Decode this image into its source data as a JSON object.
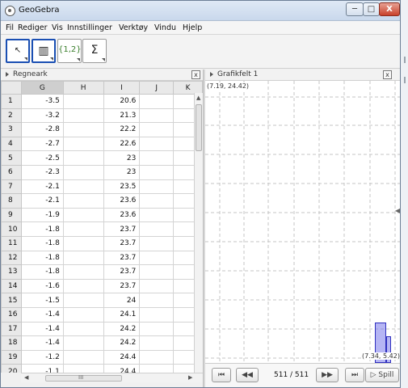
{
  "window": {
    "title": "GeoGebra",
    "min_glyph": "─",
    "max_glyph": "□",
    "close_glyph": "X"
  },
  "menu": [
    "Fil",
    "Rediger",
    "Vis",
    "Innstillinger",
    "Verktøy",
    "Vindu",
    "Hjelp"
  ],
  "toolbar": {
    "tools": [
      {
        "name": "move-tool",
        "glyph": "↖",
        "active": true
      },
      {
        "name": "histogram-tool",
        "glyph": "▥",
        "active": true
      },
      {
        "name": "list-tool",
        "glyph": "{1,2}",
        "active": false
      },
      {
        "name": "sum-tool",
        "glyph": "Σ",
        "active": false
      }
    ],
    "help_glyph": "?",
    "redo_glyph": "➦"
  },
  "spreadsheet": {
    "title": "Regneark",
    "close_glyph": "x",
    "columns": [
      "G",
      "H",
      "I",
      "J",
      "K"
    ],
    "rows": [
      {
        "n": "1",
        "G": "-3.5",
        "I": "20.6"
      },
      {
        "n": "2",
        "G": "-3.2",
        "I": "21.3"
      },
      {
        "n": "3",
        "G": "-2.8",
        "I": "22.2"
      },
      {
        "n": "4",
        "G": "-2.7",
        "I": "22.6"
      },
      {
        "n": "5",
        "G": "-2.5",
        "I": "23"
      },
      {
        "n": "6",
        "G": "-2.3",
        "I": "23"
      },
      {
        "n": "7",
        "G": "-2.1",
        "I": "23.5"
      },
      {
        "n": "8",
        "G": "-2.1",
        "I": "23.6"
      },
      {
        "n": "9",
        "G": "-1.9",
        "I": "23.6"
      },
      {
        "n": "10",
        "G": "-1.8",
        "I": "23.7"
      },
      {
        "n": "11",
        "G": "-1.8",
        "I": "23.7"
      },
      {
        "n": "12",
        "G": "-1.8",
        "I": "23.7"
      },
      {
        "n": "13",
        "G": "-1.8",
        "I": "23.7"
      },
      {
        "n": "14",
        "G": "-1.6",
        "I": "23.7"
      },
      {
        "n": "15",
        "G": "-1.5",
        "I": "24"
      },
      {
        "n": "16",
        "G": "-1.4",
        "I": "24.1"
      },
      {
        "n": "17",
        "G": "-1.4",
        "I": "24.2"
      },
      {
        "n": "18",
        "G": "-1.4",
        "I": "24.2"
      },
      {
        "n": "19",
        "G": "-1.2",
        "I": "24.4"
      },
      {
        "n": "20",
        "G": "-1.1",
        "I": "24.4"
      }
    ],
    "hscroll_glyph": "III"
  },
  "graphics": {
    "title": "Grafikfelt 1",
    "close_glyph": "x",
    "top_left_label": "(7.19, 24.42)",
    "bottom_right_label": "(7.34, 5.42)",
    "bar_heights": [
      1.0,
      0.65
    ]
  },
  "animation": {
    "first_glyph": "⏮",
    "prev_glyph": "◀◀",
    "counter": "511 / 511",
    "next_glyph": "▶▶",
    "last_glyph": "⏭",
    "play_label": "▷ Spill"
  }
}
